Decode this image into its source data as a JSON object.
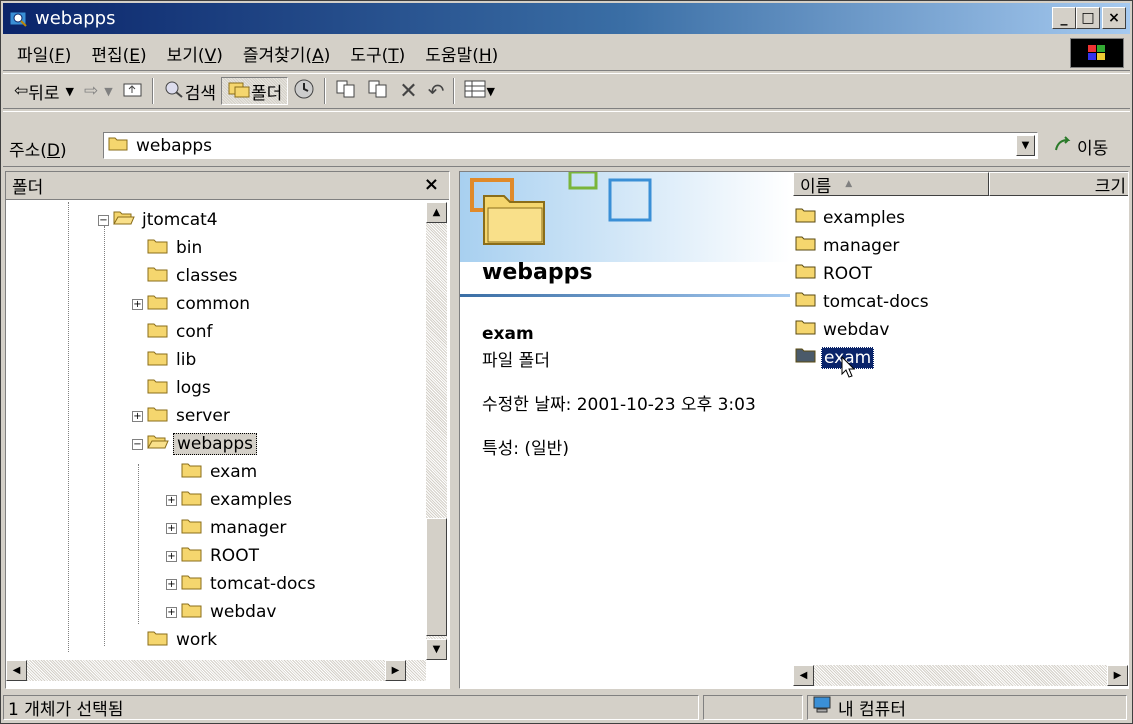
{
  "window": {
    "title": "webapps",
    "minimize": "_",
    "maximize": "□",
    "close": "×"
  },
  "menu": [
    {
      "label": "파일(",
      "key": "F",
      "end": ")"
    },
    {
      "label": "편집(",
      "key": "E",
      "end": ")"
    },
    {
      "label": "보기(",
      "key": "V",
      "end": ")"
    },
    {
      "label": "즐겨찾기(",
      "key": "A",
      "end": ")"
    },
    {
      "label": "도구(",
      "key": "T",
      "end": ")"
    },
    {
      "label": "도움말(",
      "key": "H",
      "end": ")"
    }
  ],
  "toolbar": {
    "back_label": "뒤로",
    "search_label": "검색",
    "folders_label": "폴더"
  },
  "address": {
    "label": "주소(",
    "key": "D",
    "end": ")",
    "value": "webapps",
    "go_label": "이동"
  },
  "folder_pane": {
    "title": "폴더",
    "close": "×",
    "tree": [
      {
        "label": "jtomcat4",
        "expander": "−",
        "open": true
      },
      {
        "label": "bin",
        "expander": ""
      },
      {
        "label": "classes",
        "expander": ""
      },
      {
        "label": "common",
        "expander": "+"
      },
      {
        "label": "conf",
        "expander": ""
      },
      {
        "label": "lib",
        "expander": ""
      },
      {
        "label": "logs",
        "expander": ""
      },
      {
        "label": "server",
        "expander": "+"
      },
      {
        "label": "webapps",
        "expander": "−",
        "open": true,
        "selected": true
      },
      {
        "label": "exam",
        "expander": ""
      },
      {
        "label": "examples",
        "expander": "+"
      },
      {
        "label": "manager",
        "expander": "+"
      },
      {
        "label": "ROOT",
        "expander": "+"
      },
      {
        "label": "tomcat-docs",
        "expander": "+"
      },
      {
        "label": "webdav",
        "expander": "+"
      },
      {
        "label": "work",
        "expander": ""
      }
    ]
  },
  "info": {
    "folder_title": "webapps",
    "selected_name": "exam",
    "selected_type": "파일 폴더",
    "modified": "수정한 날짜: 2001-10-23 오후 3:03",
    "attributes": "특성: (일반)"
  },
  "columns": {
    "name": "이름",
    "sort_indicator": "▲",
    "size": "크기"
  },
  "files": [
    {
      "name": "examples",
      "selected": false
    },
    {
      "name": "manager",
      "selected": false
    },
    {
      "name": "ROOT",
      "selected": false
    },
    {
      "name": "tomcat-docs",
      "selected": false
    },
    {
      "name": "webdav",
      "selected": false
    },
    {
      "name": "exam",
      "selected": true
    }
  ],
  "status": {
    "left": "1 개체가 선택됨",
    "zone": "내 컴퓨터"
  },
  "colors": {
    "titlebar_start": "#0a246a",
    "titlebar_end": "#a6caf0",
    "selection": "#0a246a",
    "folder_yellow": "#f5d66e"
  }
}
